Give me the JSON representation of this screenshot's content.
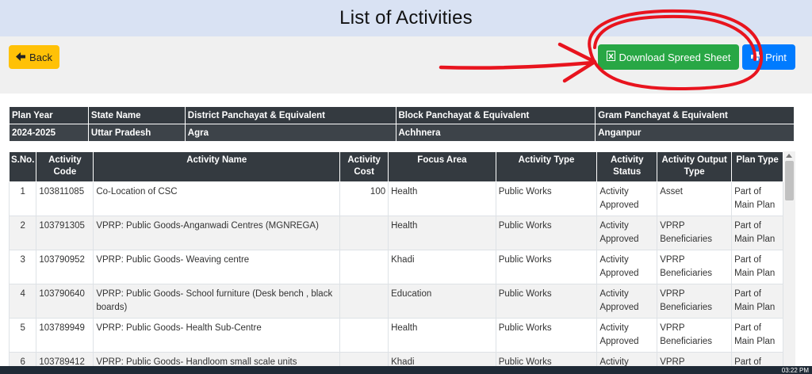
{
  "page_title": "List of Activities",
  "buttons": {
    "back": "Back",
    "download": "Download Spreed Sheet",
    "print": "Print"
  },
  "plan_info": {
    "headers": [
      "Plan Year",
      "State Name",
      "District Panchayat & Equivalent",
      "Block Panchayat & Equivalent",
      "Gram Panchayat & Equivalent"
    ],
    "values": [
      "2024-2025",
      "Uttar Pradesh",
      "Agra",
      "Achhnera",
      "Anganpur"
    ]
  },
  "activities": {
    "headers": [
      "S.No.",
      "Activity Code",
      "Activity Name",
      "Activity Cost",
      "Focus Area",
      "Activity Type",
      "Activity Status",
      "Activity Output Type",
      "Plan Type"
    ],
    "rows": [
      [
        "1",
        "103811085",
        "Co-Location of CSC",
        "100",
        "Health",
        "Public Works",
        "Activity Approved",
        "Asset",
        "Part of Main Plan"
      ],
      [
        "2",
        "103791305",
        "VPRP: Public Goods-Anganwadi Centres (MGNREGA)",
        "",
        "Health",
        "Public Works",
        "Activity Approved",
        "VPRP Beneficiaries",
        "Part of Main Plan"
      ],
      [
        "3",
        "103790952",
        "VPRP: Public Goods- Weaving centre",
        "",
        "Khadi",
        "Public Works",
        "Activity Approved",
        "VPRP Beneficiaries",
        "Part of Main Plan"
      ],
      [
        "4",
        "103790640",
        "VPRP: Public Goods- School furniture (Desk bench , black boards)",
        "",
        "Education",
        "Public Works",
        "Activity Approved",
        "VPRP Beneficiaries",
        "Part of Main Plan"
      ],
      [
        "5",
        "103789949",
        "VPRP: Public Goods- Health Sub-Centre",
        "",
        "Health",
        "Public Works",
        "Activity Approved",
        "VPRP Beneficiaries",
        "Part of Main Plan"
      ],
      [
        "6",
        "103789412",
        "VPRP: Public Goods- Handloom small scale units",
        "",
        "Khadi",
        "Public Works",
        "Activity Approved",
        "VPRP Beneficiaries",
        "Part of Main Plan"
      ]
    ]
  },
  "taskbar": {
    "time": "03:22 PM"
  },
  "colors": {
    "back": "#ffc107",
    "download": "#28a745",
    "print": "#007bff",
    "header": "#343a40",
    "annotation": "#e8141e"
  },
  "icons": {
    "back": "arrow-left-icon",
    "download": "spreadsheet-icon",
    "print": "printer-icon"
  }
}
